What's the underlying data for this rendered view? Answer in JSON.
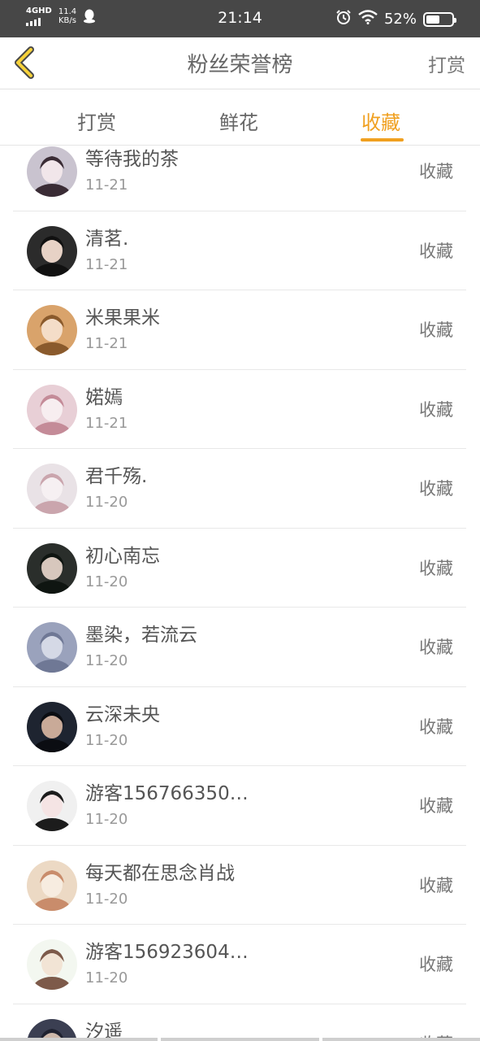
{
  "status_bar": {
    "network": "4GHD",
    "speed_value": "11.4",
    "speed_unit": "KB/s",
    "time": "21:14",
    "battery": "52%",
    "battery_level": 0.52,
    "icons": [
      "signal-icon",
      "qq-icon",
      "alarm-icon",
      "wifi-icon",
      "battery-icon"
    ]
  },
  "header": {
    "title": "粉丝荣誉榜",
    "right_action": "打赏",
    "back_icon": "chevron-left-icon"
  },
  "tabs": {
    "items": [
      "打赏",
      "鲜花",
      "收藏"
    ],
    "active_index": 2
  },
  "colors": {
    "accent": "#f0a020",
    "status_bar_bg": "#474747",
    "divider": "#e8e8e8"
  },
  "fans": [
    {
      "name": "等待我的茶",
      "date": "11-21",
      "action": "收藏"
    },
    {
      "name": "清茗.",
      "date": "11-21",
      "action": "收藏"
    },
    {
      "name": "米果果米",
      "date": "11-21",
      "action": "收藏"
    },
    {
      "name": "婼嫣",
      "date": "11-21",
      "action": "收藏"
    },
    {
      "name": "君千殇.",
      "date": "11-20",
      "action": "收藏"
    },
    {
      "name": "初心南忘",
      "date": "11-20",
      "action": "收藏"
    },
    {
      "name": "墨染，若流云",
      "date": "11-20",
      "action": "收藏"
    },
    {
      "name": "云深未央",
      "date": "11-20",
      "action": "收藏"
    },
    {
      "name": "游客156766350…",
      "date": "11-20",
      "action": "收藏"
    },
    {
      "name": "每天都在思念肖战",
      "date": "11-20",
      "action": "收藏"
    },
    {
      "name": "游客156923604…",
      "date": "11-20",
      "action": "收藏"
    },
    {
      "name": "汐遥",
      "date": "",
      "action": "收藏"
    }
  ]
}
